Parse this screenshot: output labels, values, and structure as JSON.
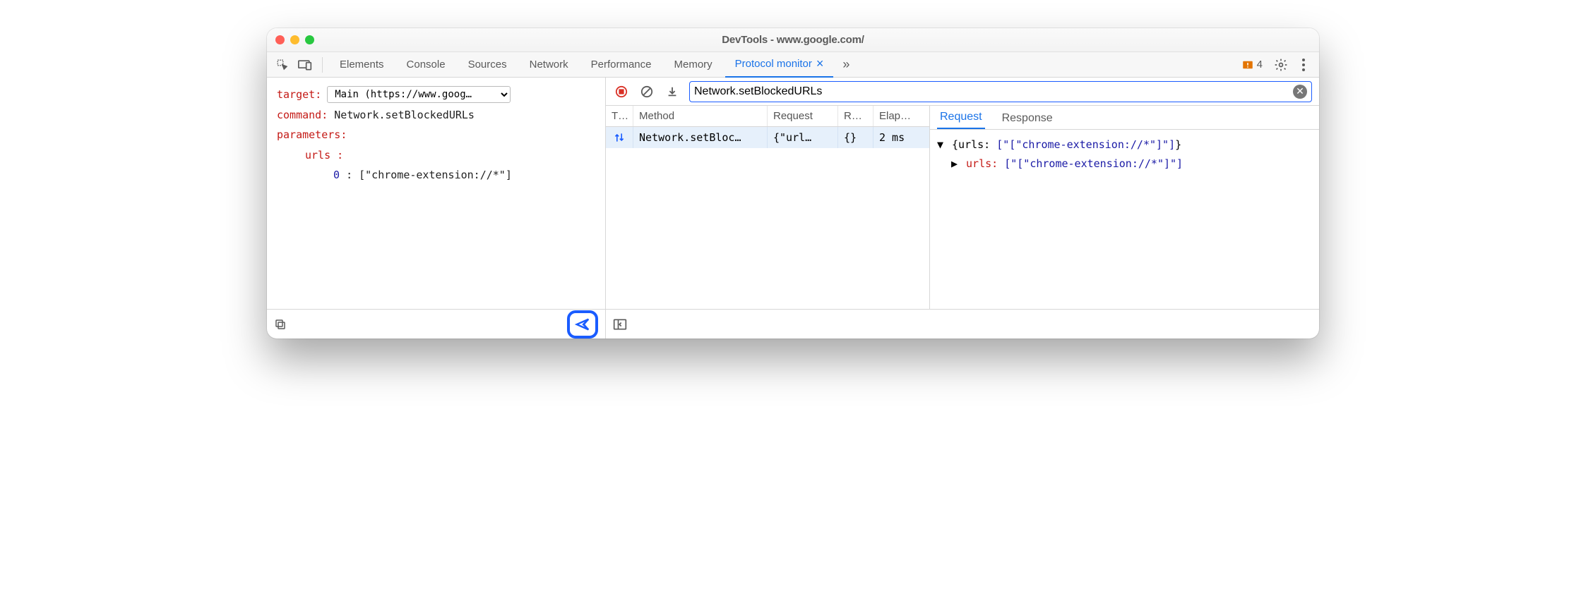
{
  "window": {
    "title": "DevTools - www.google.com/"
  },
  "tabs": {
    "items": [
      "Elements",
      "Console",
      "Sources",
      "Network",
      "Performance",
      "Memory"
    ],
    "active": "Protocol monitor",
    "more_icon": "»",
    "close_label": "×",
    "warnings": "4"
  },
  "left": {
    "target_label": "target",
    "target_value": "Main (https://www.goog…",
    "command_label": "command",
    "command_value": "Network.setBlockedURLs",
    "parameters_label": "parameters",
    "param_name": "urls",
    "index": "0",
    "index_value": "[\"chrome-extension://*\"]"
  },
  "filter": {
    "value": "Network.setBlockedURLs"
  },
  "grid": {
    "headers": {
      "type": "T…",
      "method": "Method",
      "request": "Request",
      "response": "R…",
      "elapsed": "Elap…"
    },
    "row": {
      "method": "Network.setBloc…",
      "request": "{\"url…",
      "response": "{}",
      "elapsed": "2 ms"
    }
  },
  "detail": {
    "tab_request": "Request",
    "tab_response": "Response",
    "line1_pre": "{urls: ",
    "line1_val": "[\"[\"chrome-extension://*\"]\"]",
    "line1_post": "}",
    "line2_key": "urls",
    "line2_val": "[\"[\"chrome-extension://*\"]\"]"
  }
}
